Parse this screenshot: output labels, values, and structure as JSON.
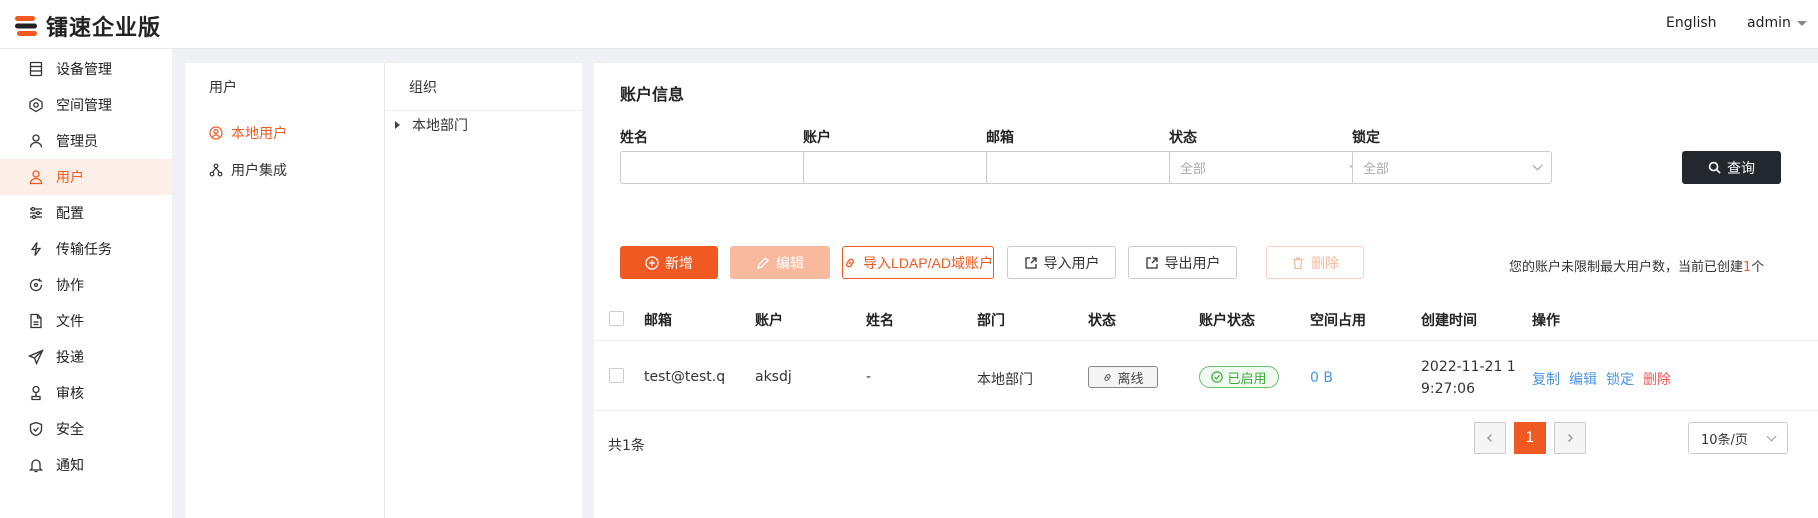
{
  "header": {
    "logo_text": "镭速企业版",
    "language": "English",
    "user": "admin"
  },
  "sidebar": {
    "items": [
      {
        "label": "设备管理",
        "icon": "device-list-icon"
      },
      {
        "label": "空间管理",
        "icon": "space-icon"
      },
      {
        "label": "管理员",
        "icon": "admin-icon"
      },
      {
        "label": "用户",
        "icon": "user-icon",
        "active": true
      },
      {
        "label": "配置",
        "icon": "sliders-icon"
      },
      {
        "label": "传输任务",
        "icon": "transfer-icon"
      },
      {
        "label": "协作",
        "icon": "collab-icon"
      },
      {
        "label": "文件",
        "icon": "file-icon"
      },
      {
        "label": "投递",
        "icon": "send-icon"
      },
      {
        "label": "审核",
        "icon": "audit-icon"
      },
      {
        "label": "安全",
        "icon": "shield-icon"
      },
      {
        "label": "通知",
        "icon": "bell-icon"
      }
    ]
  },
  "user_panel": {
    "title": "用户",
    "items": [
      "本地用户",
      "用户集成"
    ]
  },
  "org_panel": {
    "title": "组织",
    "node": "本地部门"
  },
  "main": {
    "title": "账户信息",
    "filters": {
      "name_label": "姓名",
      "account_label": "账户",
      "email_label": "邮箱",
      "status_label": "状态",
      "status_value": "全部",
      "lock_label": "锁定",
      "lock_value": "全部",
      "query_button": "查询"
    },
    "toolbar": {
      "add": "新增",
      "edit": "编辑",
      "import_ldap": "导入LDAP/AD域账户",
      "import_users": "导入用户",
      "export_users": "导出用户",
      "delete": "删除"
    },
    "limit_text_pre": "您的账户未限制最大用户数，当前已创建",
    "limit_count": "1",
    "limit_text_post": "个",
    "table": {
      "columns": [
        "邮箱",
        "账户",
        "姓名",
        "部门",
        "状态",
        "账户状态",
        "空间占用",
        "创建时间",
        "操作"
      ],
      "rows": [
        {
          "email": "test@test.q",
          "account": "aksdj",
          "name": "-",
          "dept": "本地部门",
          "status": "离线",
          "account_status": "已启用",
          "space": "0 B",
          "created_line1": "2022-11-21 1",
          "created_line2": "9:27:06",
          "actions": [
            "复制",
            "编辑",
            "锁定",
            "删除"
          ]
        }
      ]
    },
    "pagination": {
      "total": "共1条",
      "current": "1",
      "page_size": "10条/页"
    }
  },
  "colors": {
    "accent": "#f05a22",
    "link": "#4b96e6",
    "success": "#3cab3c",
    "danger": "#f05a5a",
    "dark_button": "#23272e"
  }
}
